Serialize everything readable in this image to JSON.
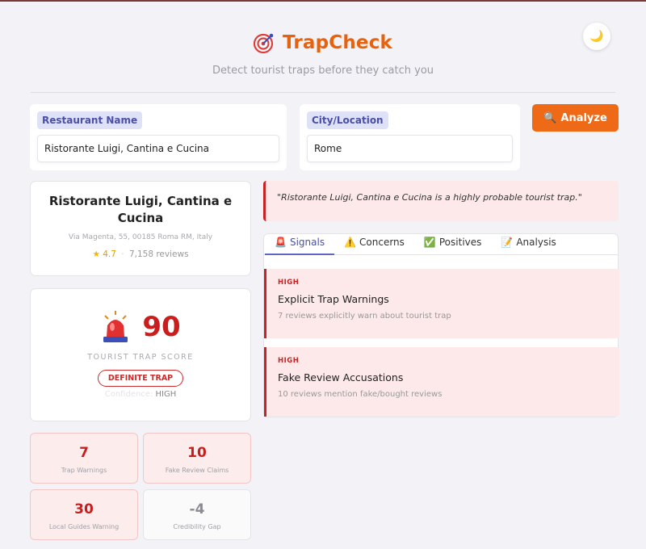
{
  "app": {
    "name": "TrapCheck",
    "tagline": "Detect tourist traps before they catch you",
    "theme_toggle": "🌙"
  },
  "search": {
    "restaurant_label": "Restaurant Name",
    "restaurant_value": "Ristorante Luigi, Cantina e Cucina",
    "city_label": "City/Location",
    "city_value": "Rome",
    "analyze_icon": "🔍",
    "analyze_label": "Analyze"
  },
  "restaurant": {
    "name": "Ristorante Luigi, Cantina e Cucina",
    "address": "Via Magenta, 55, 00185 Roma RM, Italy",
    "star": "★",
    "rating": "4.7",
    "separator": "·",
    "reviews": "7,158 reviews"
  },
  "score": {
    "value": "90",
    "label": "TOURIST TRAP SCORE",
    "verdict": "DEFINITE TRAP",
    "confidence_label": "Confidence:",
    "confidence_value": "HIGH"
  },
  "stats": [
    {
      "value": "7",
      "label": "Trap Warnings"
    },
    {
      "value": "10",
      "label": "Fake Review Claims"
    },
    {
      "value": "30",
      "label": "Local Guides Warning"
    },
    {
      "value": "-4",
      "label": "Credibility Gap"
    }
  ],
  "summary_quote": "\"Ristorante Luigi, Cantina e Cucina is a highly probable tourist trap.\"",
  "tabs": [
    {
      "icon": "🚨",
      "label": "Signals"
    },
    {
      "icon": "⚠️",
      "label": "Concerns"
    },
    {
      "icon": "✅",
      "label": "Positives"
    },
    {
      "icon": "📝",
      "label": "Analysis"
    }
  ],
  "signals": [
    {
      "severity": "HIGH",
      "title": "Explicit Trap Warnings",
      "description": "7 reviews explicitly warn about tourist trap"
    },
    {
      "severity": "HIGH",
      "title": "Fake Review Accusations",
      "description": "10 reviews mention fake/bought reviews"
    }
  ],
  "colors": {
    "brand": "#e8620e",
    "danger": "#c81e1e",
    "accent": "#4a4fa8"
  },
  "icons": {
    "logo": "target-icon",
    "theme": "moon-icon",
    "analyze": "search-icon",
    "score": "siren-icon"
  }
}
